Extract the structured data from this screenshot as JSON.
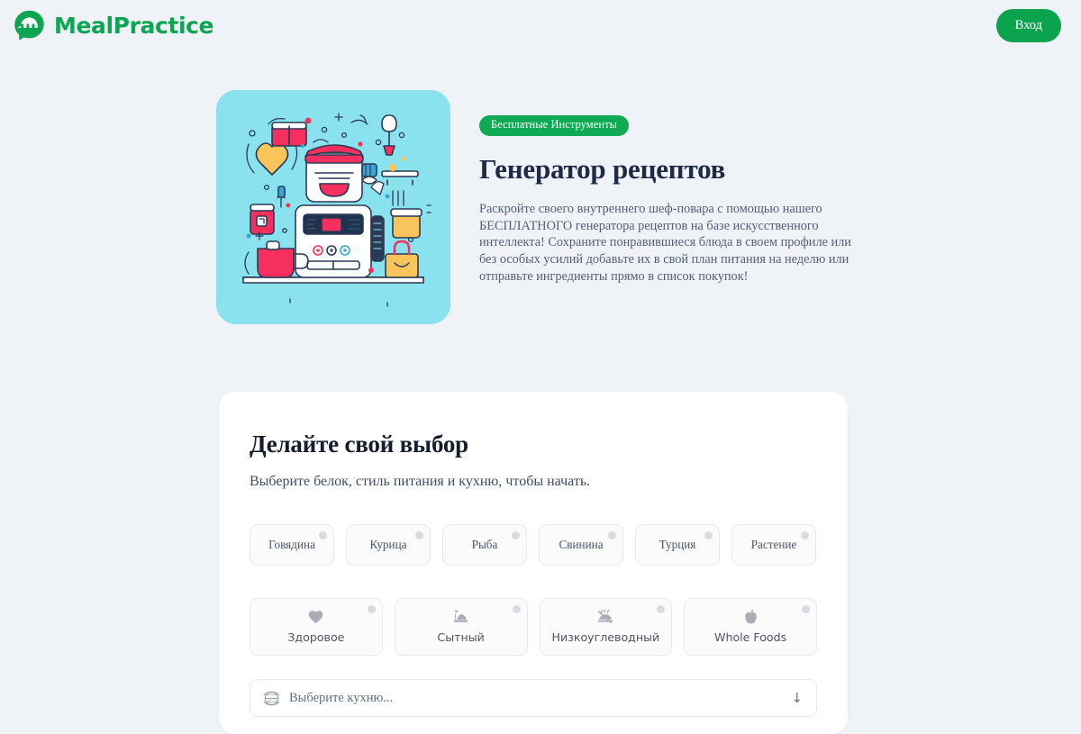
{
  "brand": {
    "name": "MealPractice",
    "logo_icon": "mealpractice-speech-bubble-logo",
    "color": "#0ca552"
  },
  "header": {
    "login_label": "Вход",
    "login_color": "#0ca34f"
  },
  "hero": {
    "illustration_icon": "kitchen-appliances-illustration",
    "illustration_bg": "#8ae2ef",
    "badge_label": "Бесплатные Инструменты",
    "badge_color": "#0faa53",
    "title": "Генератор рецептов",
    "description": "Раскройте своего внутреннего шеф-повара с помощью нашего БЕСПЛАТНОГО генератора рецептов на базе искусственного интеллекта! Сохраните понравившиеся блюда в своем профиле или без особых усилий добавьте их в свой план питания на неделю или отправьте ингредиенты прямо в список покупок!"
  },
  "panel": {
    "title": "Делайте свой выбор",
    "subtitle": "Выберите белок, стиль питания и кухню, чтобы начать.",
    "proteins": [
      {
        "label": "Говядина"
      },
      {
        "label": "Курица"
      },
      {
        "label": "Рыба"
      },
      {
        "label": "Свинина"
      },
      {
        "label": "Турция"
      },
      {
        "label": "Растение"
      }
    ],
    "diets": [
      {
        "label": "Здоровое",
        "icon": "heart-icon"
      },
      {
        "label": "Сытный",
        "icon": "bowl-icon"
      },
      {
        "label": "Низкоуглеводный",
        "icon": "steaming-dish-icon"
      },
      {
        "label": "Whole Foods",
        "icon": "apple-icon"
      }
    ],
    "cuisine": {
      "icon": "globe-icon",
      "placeholder": "Выберите кухню...",
      "caret": "↓"
    }
  }
}
